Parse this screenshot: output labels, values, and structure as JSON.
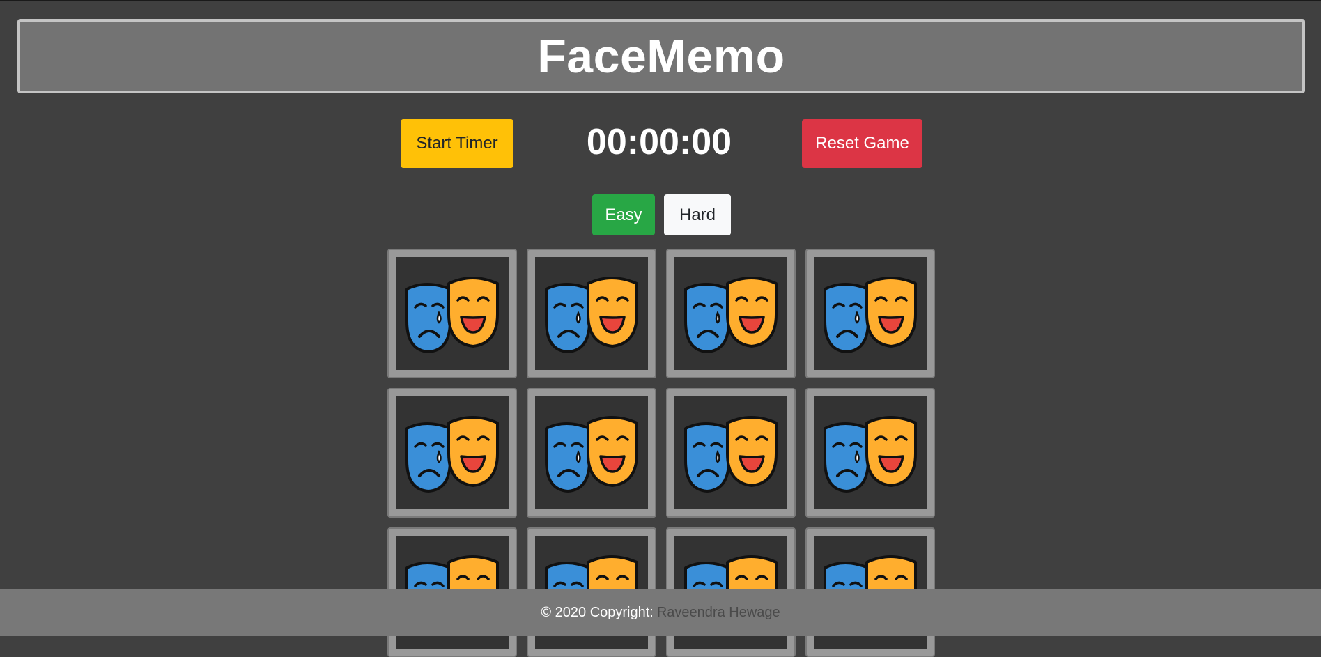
{
  "app": {
    "title": "FaceMemo"
  },
  "controls": {
    "start_label": "Start Timer",
    "timer_value": "00:00:00",
    "reset_label": "Reset Game",
    "easy_label": "Easy",
    "hard_label": "Hard"
  },
  "board": {
    "rows": 3,
    "cols": 4,
    "card_icon": "theater-masks-icon",
    "colors": {
      "sad_mask": "#3a8fd8",
      "happy_mask": "#ffae2e",
      "card_frame": "#999999",
      "card_face": "#333333"
    }
  },
  "footer": {
    "copyright_label": "© 2020 Copyright:",
    "author": "Raveendra Hewage"
  },
  "colors": {
    "background": "#404040",
    "header": "#737373",
    "start": "#ffc107",
    "reset": "#dc3545",
    "easy": "#28a745",
    "hard": "#f8f9fa",
    "footer": "#787878"
  }
}
